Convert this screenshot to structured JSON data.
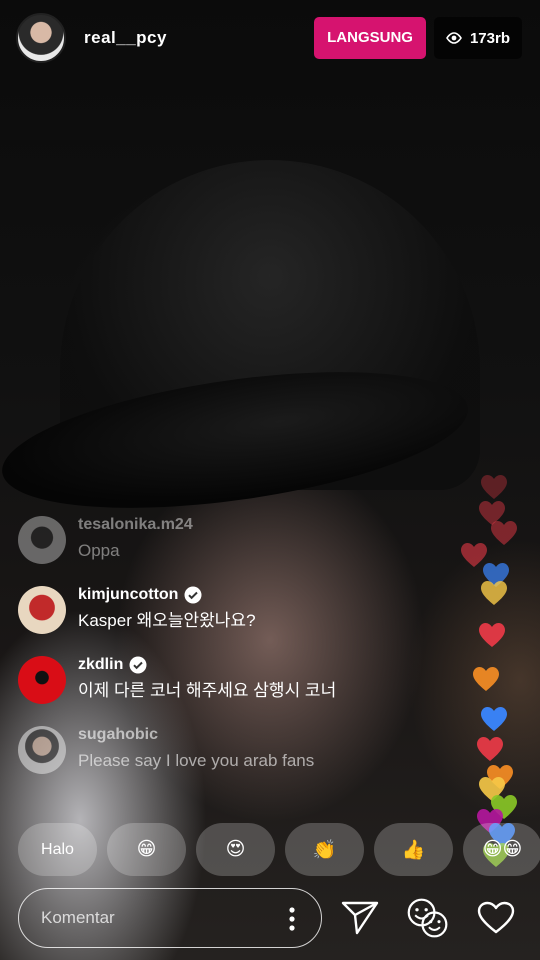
{
  "stream": {
    "username": "real__pcy",
    "live_label": "LANGSUNG",
    "viewer_count": "173rb"
  },
  "comments": [
    {
      "user": "tesalonika.m24",
      "text": "Oppa",
      "verified": false
    },
    {
      "user": "kimjuncotton",
      "text": "Kasper 왜오늘안왔나요?",
      "verified": true
    },
    {
      "user": "zkdlin",
      "text": "이제 다른 코너 해주세요 삼행시 코너",
      "verified": true
    },
    {
      "user": "sugahobic",
      "text": "Please say I love you arab fans",
      "verified": false
    }
  ],
  "quick_reactions": [
    {
      "label": "Halo",
      "type": "text"
    },
    {
      "label": "😁",
      "type": "emoji"
    },
    {
      "label": "😍",
      "type": "emoji"
    },
    {
      "label": "👏",
      "type": "emoji"
    },
    {
      "label": "👍",
      "type": "emoji"
    },
    {
      "label": "😁😁",
      "type": "emoji"
    }
  ],
  "comment_box": {
    "placeholder": "Komentar"
  },
  "icons": {
    "viewers": "eye-icon",
    "verified": "verified-badge-icon",
    "more": "more-vertical-icon",
    "send": "send-icon",
    "face": "face-filter-icon",
    "like": "heart-icon"
  },
  "colors": {
    "live_badge": "#d6136f",
    "hearts": [
      "#e63946",
      "#f08a24",
      "#3a86ff",
      "#b5179e",
      "#f7c948",
      "#8ac926"
    ]
  }
}
